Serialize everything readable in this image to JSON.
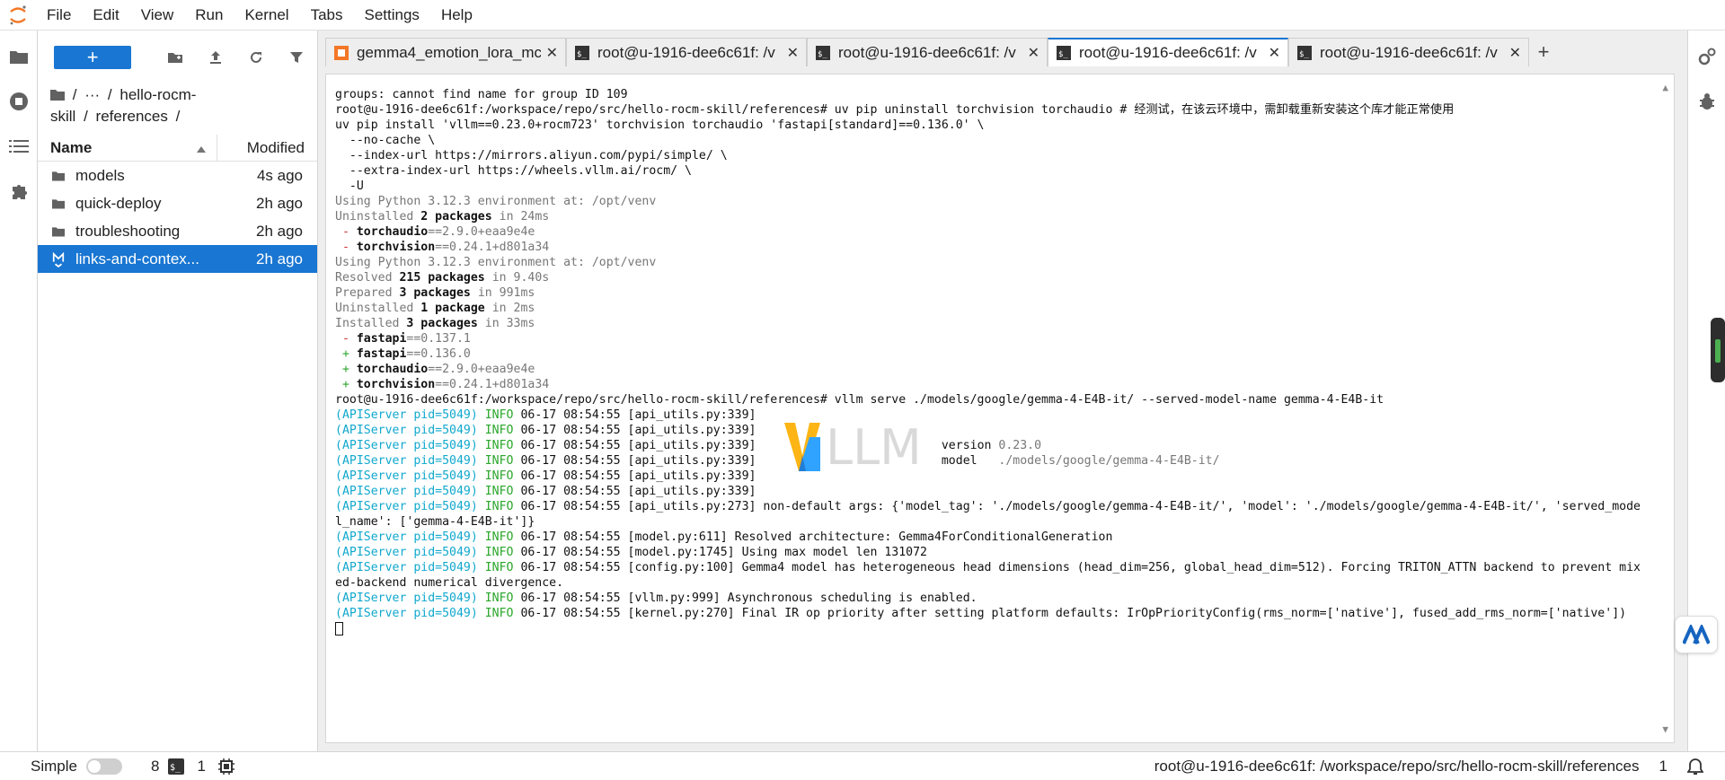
{
  "menu": {
    "items": [
      "File",
      "Edit",
      "View",
      "Run",
      "Kernel",
      "Tabs",
      "Settings",
      "Help"
    ]
  },
  "filebrowser": {
    "new_label": "+",
    "breadcrumb": {
      "root": "/",
      "ellipsis": "···",
      "sep1": "/",
      "seg1": "hello-rocm-",
      "seg2": "skill",
      "sep2": "/",
      "seg3": "references",
      "sep3": "/"
    },
    "columns": {
      "name": "Name",
      "modified": "Modified"
    },
    "files": [
      {
        "name": "models",
        "modified": "4s ago",
        "type": "folder"
      },
      {
        "name": "quick-deploy",
        "modified": "2h ago",
        "type": "folder"
      },
      {
        "name": "troubleshooting",
        "modified": "2h ago",
        "type": "folder"
      },
      {
        "name": "links-and-contex...",
        "modified": "2h ago",
        "type": "markdown"
      }
    ]
  },
  "tabs": [
    {
      "label": "gemma4_emotion_lora_mc",
      "type": "notebook",
      "active": false
    },
    {
      "label": "root@u-1916-dee6c61f: /v",
      "type": "terminal",
      "active": false
    },
    {
      "label": "root@u-1916-dee6c61f: /v",
      "type": "terminal",
      "active": false
    },
    {
      "label": "root@u-1916-dee6c61f: /v",
      "type": "terminal",
      "active": true
    },
    {
      "label": "root@u-1916-dee6c61f: /v",
      "type": "terminal",
      "active": false
    }
  ],
  "tab_add": "+",
  "tab_close": "✕",
  "terminal": {
    "lines": [
      [
        {
          "t": "groups: cannot find name for group ID 109",
          "c": ""
        }
      ],
      [
        {
          "t": "root@u-1916-dee6c61f:/workspace/repo/src/hello-rocm-skill/references# uv pip uninstall torchvision torchaudio # 经测试，在该云环境中，需卸载重新安装这个库才能正常使用",
          "c": ""
        }
      ],
      [
        {
          "t": "uv pip install 'vllm==0.23.0+rocm723' torchvision torchaudio 'fastapi[standard]==0.136.0' \\",
          "c": ""
        }
      ],
      [
        {
          "t": "  --no-cache \\",
          "c": ""
        }
      ],
      [
        {
          "t": "  --index-url https://mirrors.aliyun.com/pypi/simple/ \\",
          "c": ""
        }
      ],
      [
        {
          "t": "  --extra-index-url https://wheels.vllm.ai/rocm/ \\",
          "c": ""
        }
      ],
      [
        {
          "t": "  -U",
          "c": ""
        }
      ],
      [
        {
          "t": "Using Python 3.12.3 environment at: /opt/venv",
          "c": "c-gray"
        }
      ],
      [
        {
          "t": "Uninstalled ",
          "c": "c-gray"
        },
        {
          "t": "2 packages",
          "c": "c-bold"
        },
        {
          "t": " in 24ms",
          "c": "c-gray"
        }
      ],
      [
        {
          "t": " - ",
          "c": "c-red"
        },
        {
          "t": "torchaudio",
          "c": "c-bold"
        },
        {
          "t": "==2.9.0+eaa9e4e",
          "c": "c-gray"
        }
      ],
      [
        {
          "t": " - ",
          "c": "c-red"
        },
        {
          "t": "torchvision",
          "c": "c-bold"
        },
        {
          "t": "==0.24.1+d801a34",
          "c": "c-gray"
        }
      ],
      [
        {
          "t": "Using Python 3.12.3 environment at: /opt/venv",
          "c": "c-gray"
        }
      ],
      [
        {
          "t": "Resolved ",
          "c": "c-gray"
        },
        {
          "t": "215 packages",
          "c": "c-bold"
        },
        {
          "t": " in 9.40s",
          "c": "c-gray"
        }
      ],
      [
        {
          "t": "Prepared ",
          "c": "c-gray"
        },
        {
          "t": "3 packages",
          "c": "c-bold"
        },
        {
          "t": " in 991ms",
          "c": "c-gray"
        }
      ],
      [
        {
          "t": "Uninstalled ",
          "c": "c-gray"
        },
        {
          "t": "1 package",
          "c": "c-bold"
        },
        {
          "t": " in 2ms",
          "c": "c-gray"
        }
      ],
      [
        {
          "t": "Installed ",
          "c": "c-gray"
        },
        {
          "t": "3 packages",
          "c": "c-bold"
        },
        {
          "t": " in 33ms",
          "c": "c-gray"
        }
      ],
      [
        {
          "t": " - ",
          "c": "c-red"
        },
        {
          "t": "fastapi",
          "c": "c-bold"
        },
        {
          "t": "==0.137.1",
          "c": "c-gray"
        }
      ],
      [
        {
          "t": " + ",
          "c": "c-green"
        },
        {
          "t": "fastapi",
          "c": "c-bold"
        },
        {
          "t": "==0.136.0",
          "c": "c-gray"
        }
      ],
      [
        {
          "t": " + ",
          "c": "c-green"
        },
        {
          "t": "torchaudio",
          "c": "c-bold"
        },
        {
          "t": "==2.9.0+eaa9e4e",
          "c": "c-gray"
        }
      ],
      [
        {
          "t": " + ",
          "c": "c-green"
        },
        {
          "t": "torchvision",
          "c": "c-bold"
        },
        {
          "t": "==0.24.1+d801a34",
          "c": "c-gray"
        }
      ],
      [
        {
          "t": "root@u-1916-dee6c61f:/workspace/repo/src/hello-rocm-skill/references# vllm serve ./models/google/gemma-4-E4B-it/ --served-model-name gemma-4-E4B-it",
          "c": ""
        }
      ],
      [
        {
          "t": "(APIServer pid=5049) ",
          "c": "c-cyan"
        },
        {
          "t": "INFO",
          "c": "c-green"
        },
        {
          "t": " 06-17 08:54:55 [api_utils.py:339]",
          "c": ""
        }
      ],
      [
        {
          "t": "(APIServer pid=5049) ",
          "c": "c-cyan"
        },
        {
          "t": "INFO",
          "c": "c-green"
        },
        {
          "t": " 06-17 08:54:55 [api_utils.py:339]",
          "c": ""
        }
      ],
      [
        {
          "t": "(APIServer pid=5049) ",
          "c": "c-cyan"
        },
        {
          "t": "INFO",
          "c": "c-green"
        },
        {
          "t": " 06-17 08:54:55 [api_utils.py:339]                          version ",
          "c": ""
        },
        {
          "t": "0.23.0",
          "c": "c-gray"
        }
      ],
      [
        {
          "t": "(APIServer pid=5049) ",
          "c": "c-cyan"
        },
        {
          "t": "INFO",
          "c": "c-green"
        },
        {
          "t": " 06-17 08:54:55 [api_utils.py:339]                          model   ",
          "c": ""
        },
        {
          "t": "./models/google/gemma-4-E4B-it/",
          "c": "c-gray"
        }
      ],
      [
        {
          "t": "(APIServer pid=5049) ",
          "c": "c-cyan"
        },
        {
          "t": "INFO",
          "c": "c-green"
        },
        {
          "t": " 06-17 08:54:55 [api_utils.py:339]",
          "c": ""
        }
      ],
      [
        {
          "t": "(APIServer pid=5049) ",
          "c": "c-cyan"
        },
        {
          "t": "INFO",
          "c": "c-green"
        },
        {
          "t": " 06-17 08:54:55 [api_utils.py:339]",
          "c": ""
        }
      ],
      [
        {
          "t": "(APIServer pid=5049) ",
          "c": "c-cyan"
        },
        {
          "t": "INFO",
          "c": "c-green"
        },
        {
          "t": " 06-17 08:54:55 [api_utils.py:273] non-default args: {'model_tag': './models/google/gemma-4-E4B-it/', 'model': './models/google/gemma-4-E4B-it/', 'served_mode",
          "c": ""
        }
      ],
      [
        {
          "t": "l_name': ['gemma-4-E4B-it']}",
          "c": ""
        }
      ],
      [
        {
          "t": "(APIServer pid=5049) ",
          "c": "c-cyan"
        },
        {
          "t": "INFO",
          "c": "c-green"
        },
        {
          "t": " 06-17 08:54:55 [model.py:611] Resolved architecture: Gemma4ForConditionalGeneration",
          "c": ""
        }
      ],
      [
        {
          "t": "(APIServer pid=5049) ",
          "c": "c-cyan"
        },
        {
          "t": "INFO",
          "c": "c-green"
        },
        {
          "t": " 06-17 08:54:55 [model.py:1745] Using max model len 131072",
          "c": ""
        }
      ],
      [
        {
          "t": "(APIServer pid=5049) ",
          "c": "c-cyan"
        },
        {
          "t": "INFO",
          "c": "c-green"
        },
        {
          "t": " 06-17 08:54:55 [config.py:100] Gemma4 model has heterogeneous head dimensions (head_dim=256, global_head_dim=512). Forcing TRITON_ATTN backend to prevent mix",
          "c": ""
        }
      ],
      [
        {
          "t": "ed-backend numerical divergence.",
          "c": ""
        }
      ],
      [
        {
          "t": "(APIServer pid=5049) ",
          "c": "c-cyan"
        },
        {
          "t": "INFO",
          "c": "c-green"
        },
        {
          "t": " 06-17 08:54:55 [vllm.py:999] Asynchronous scheduling is enabled.",
          "c": ""
        }
      ],
      [
        {
          "t": "(APIServer pid=5049) ",
          "c": "c-cyan"
        },
        {
          "t": "INFO",
          "c": "c-green"
        },
        {
          "t": " 06-17 08:54:55 [kernel.py:270] Final IR op priority after setting platform defaults: IrOpPriorityConfig(rms_norm=['native'], fused_add_rms_norm=['native'])",
          "c": ""
        }
      ]
    ]
  },
  "statusbar": {
    "simple_label": "Simple",
    "kernels_count": "8",
    "terminals_count": "1",
    "path": "root@u-1916-dee6c61f: /workspace/repo/src/hello-rocm-skill/references",
    "notifications_count": "1"
  },
  "colors": {
    "accent": "#1976d2",
    "terminal_cyan": "#11a8cd",
    "terminal_green": "#2aa62a",
    "terminal_red": "#cd3131"
  }
}
